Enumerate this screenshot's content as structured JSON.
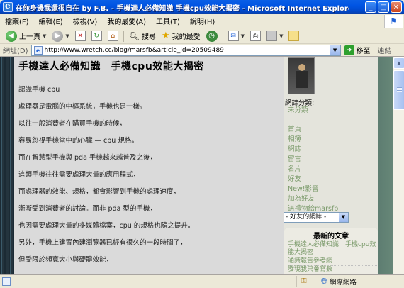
{
  "window": {
    "title": "在你身邊我還很自在 by F.B. - 手機達人必備知識 手機cpu效能大揭密 - Microsoft Internet Explorer",
    "min": "_",
    "max": "□",
    "close": "✕"
  },
  "menu": {
    "items": [
      "檔案(F)",
      "編輯(E)",
      "檢視(V)",
      "我的最愛(A)",
      "工具(T)",
      "說明(H)"
    ]
  },
  "toolbar": {
    "back": "上一頁",
    "search": "搜尋",
    "favorites": "我的最愛"
  },
  "address": {
    "label": "網址(D)",
    "url": "http://www.wretch.cc/blog/marsfb&article_id=20509489",
    "go": "移至",
    "links": "連結"
  },
  "article": {
    "title": "手機達人必備知識　手機cpu效能大揭密",
    "paragraphs": [
      "認識手機 cpu",
      "處理器是電腦的中樞系統，手機也是一樣。",
      "以往一般消費者在購買手機的時候，",
      "容易忽視手機當中的心臟 — cpu 規格。",
      "而在智慧型手機與 pda 手機越來越普及之後，",
      "這類手機往往需要處理大量的應用程式，",
      "而處理器的效能、規格，都會影響到手機的處理速度，",
      "漸漸受到消費者的討論。而非 pda 型的手機，",
      "也因需要處理大量的多媒體檔案，cpu 的規格也隨之提升。",
      "另外，手機上建置內建瀏覽器已經有很久的一段時間了，",
      "但受限於頻寬大小與硬體效能，"
    ]
  },
  "sidebar": {
    "category_title": "網誌分類:",
    "uncategorized": "未分類",
    "nav": [
      "首頁",
      "相簿",
      "網誌",
      "留言",
      "名片",
      "好友",
      "New!影音",
      "加為好友",
      "送禮物給marsfb"
    ],
    "friends_select": "- 好友的網誌 -",
    "recent_title": "最新的文章",
    "recent_articles": [
      "手機達人必備知識　手機cpu效能大揭密",
      "通識報告參考網",
      "發現我只會寫數"
    ]
  },
  "status": {
    "zone": "網際網路"
  }
}
